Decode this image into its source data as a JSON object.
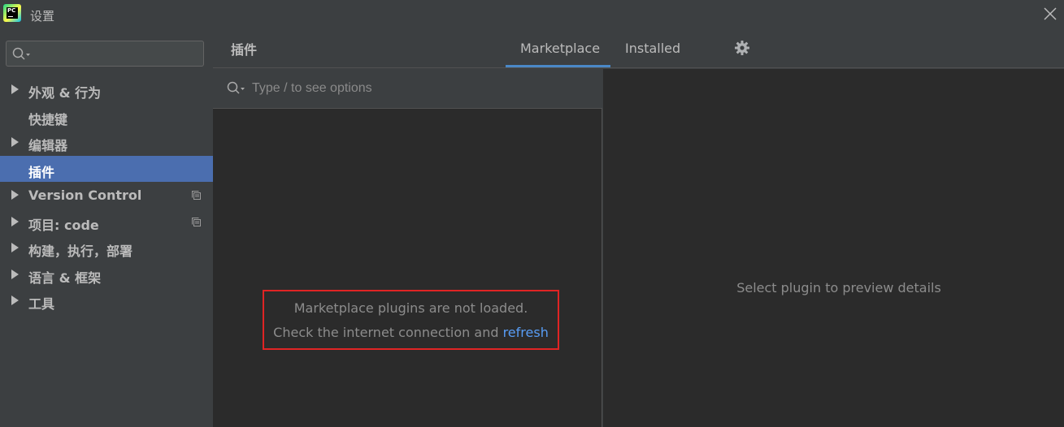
{
  "window": {
    "title": "设置",
    "logo_text": "PC"
  },
  "sidebar": {
    "search_value": "",
    "items": [
      {
        "label": "外观 & 行为",
        "expandable": true,
        "selected": false,
        "copy_icon": false
      },
      {
        "label": "快捷键",
        "expandable": false,
        "selected": false,
        "copy_icon": false
      },
      {
        "label": "编辑器",
        "expandable": true,
        "selected": false,
        "copy_icon": false
      },
      {
        "label": "插件",
        "expandable": false,
        "selected": true,
        "copy_icon": false
      },
      {
        "label": "Version Control",
        "expandable": true,
        "selected": false,
        "copy_icon": true
      },
      {
        "label": "项目: code",
        "expandable": true,
        "selected": false,
        "copy_icon": true
      },
      {
        "label": "构建，执行，部署",
        "expandable": true,
        "selected": false,
        "copy_icon": false
      },
      {
        "label": "语言 & 框架",
        "expandable": true,
        "selected": false,
        "copy_icon": false
      },
      {
        "label": "工具",
        "expandable": true,
        "selected": false,
        "copy_icon": false
      }
    ]
  },
  "header": {
    "title": "插件",
    "tabs": [
      {
        "label": "Marketplace",
        "active": true
      },
      {
        "label": "Installed",
        "active": false
      }
    ],
    "settings_icon": "gear-icon"
  },
  "plugins": {
    "search_placeholder": "Type / to see options",
    "notice_line1": "Marketplace plugins are not loaded.",
    "notice_line2_prefix": "Check the internet connection and ",
    "notice_link": "refresh"
  },
  "details": {
    "hint": "Select plugin to preview details"
  },
  "colors": {
    "accent": "#4b6eaf",
    "tab_underline": "#4a88c7",
    "link": "#589df6",
    "highlight_border": "#e02424"
  }
}
